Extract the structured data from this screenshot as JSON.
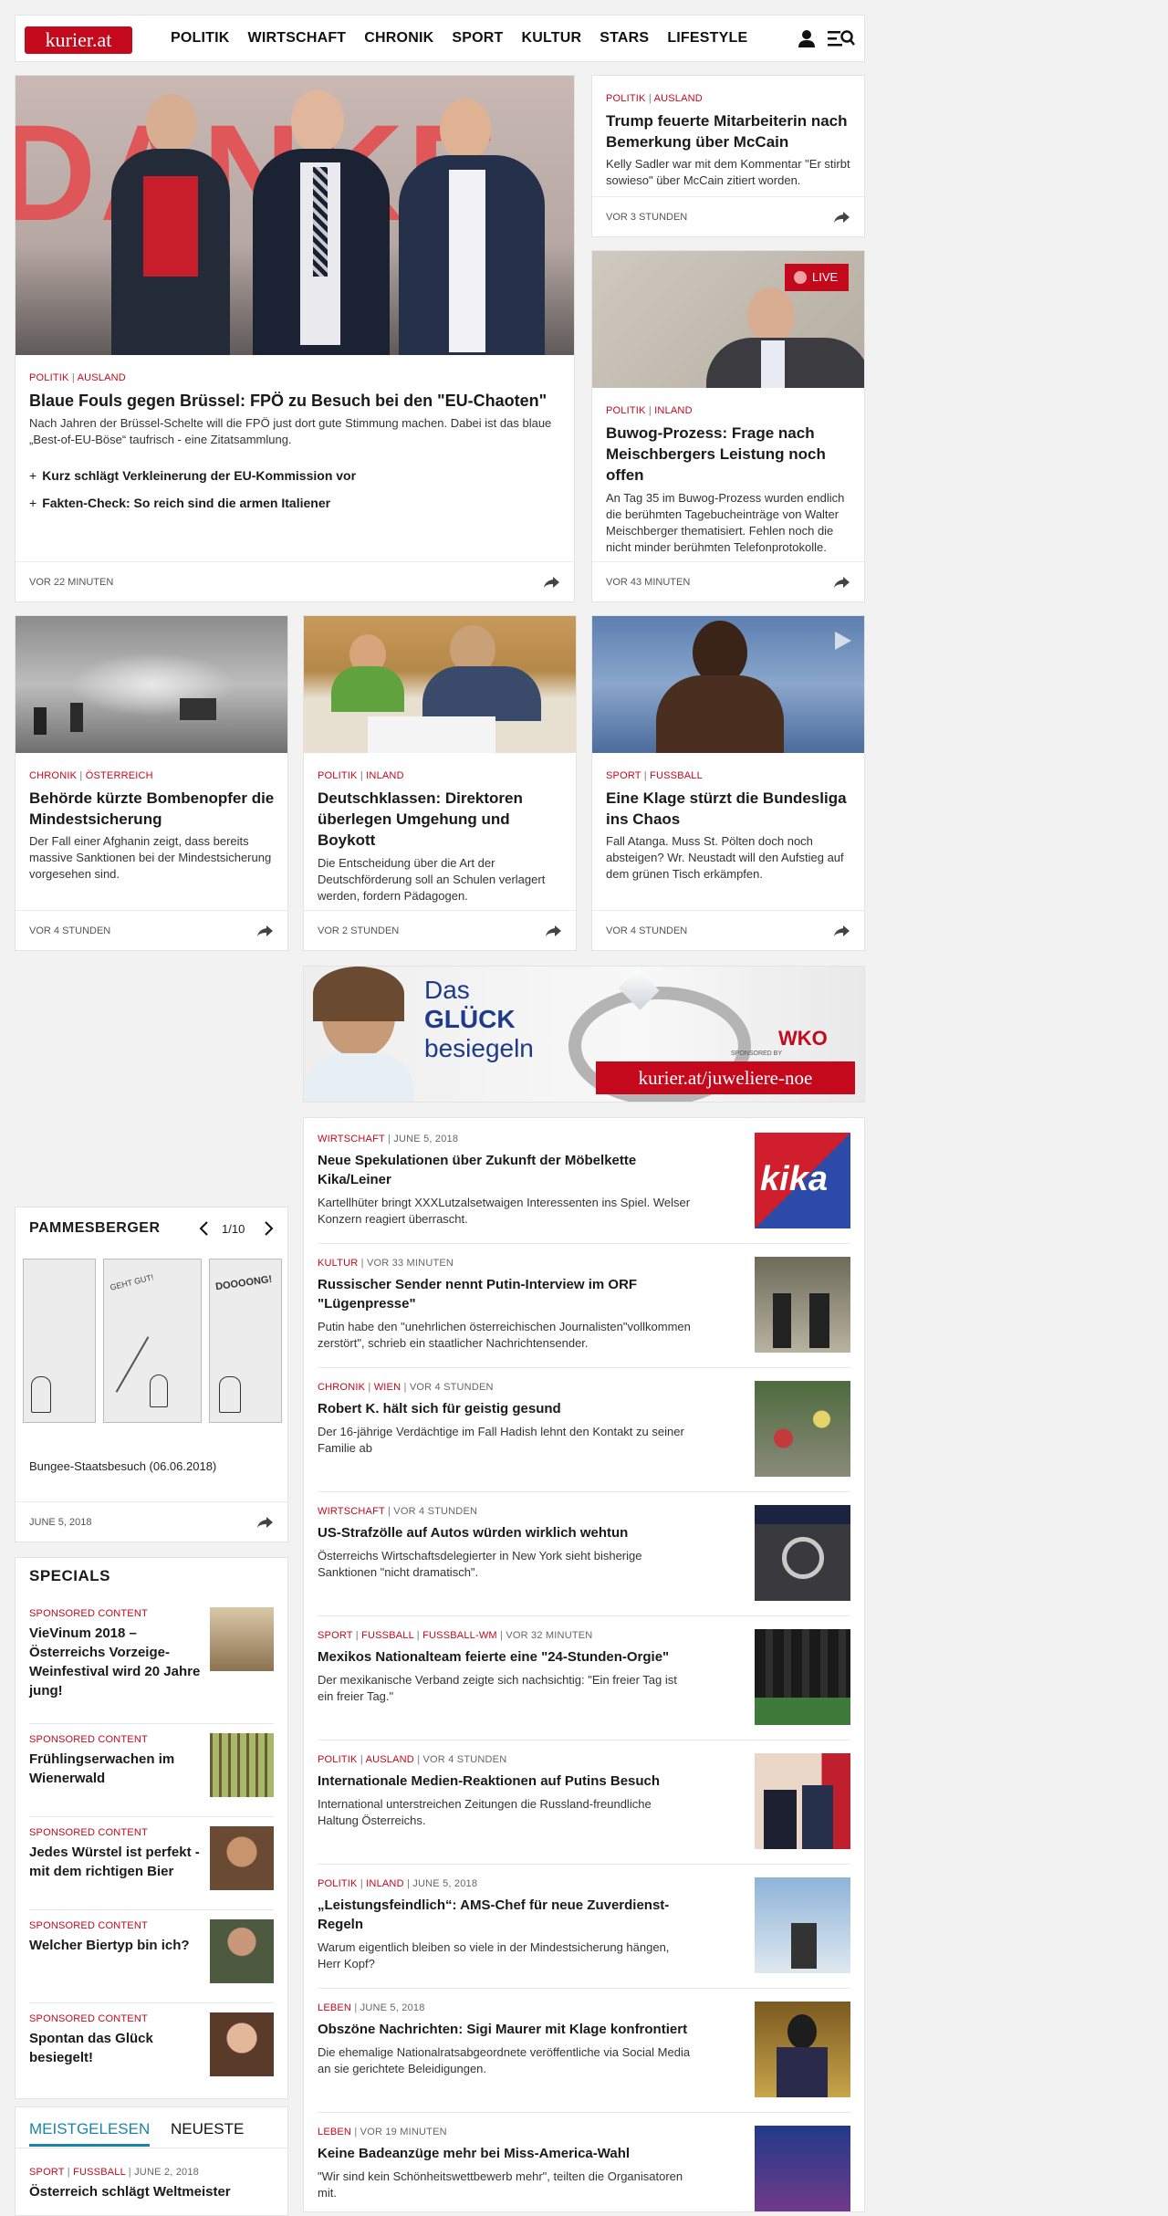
{
  "header": {
    "logo": "kurier.at",
    "nav": [
      "POLITIK",
      "WIRTSCHAFT",
      "CHRONIK",
      "SPORT",
      "KULTUR",
      "STARS",
      "LIFESTYLE"
    ]
  },
  "hero": {
    "cat1": "POLITIK",
    "cat2": "AUSLAND",
    "title": "Blaue Fouls gegen Brüssel: FPÖ zu Besuch bei den \"EU-Chaoten\"",
    "teaser": "Nach Jahren der Brüssel-Schelte will die FPÖ just dort gute Stimmung machen. Dabei ist das blaue „Best-of-EU-Böse“ taufrisch - eine Zitatsammlung.",
    "related": [
      "Kurz schlägt Verkleinerung der EU-Kommission vor",
      "Fakten-Check: So reich sind die armen Italiener"
    ],
    "time": "VOR 22 MINUTEN",
    "banner_text": "DANKE"
  },
  "side1": {
    "cat1": "POLITIK",
    "cat2": "AUSLAND",
    "title": "Trump feuerte Mitarbeiterin nach Bemerkung über McCain",
    "teaser": "Kelly Sadler war mit dem Kommentar \"Er stirbt sowieso\" über McCain zitiert worden.",
    "time": "VOR 3 STUNDEN"
  },
  "side2": {
    "live": "LIVE",
    "cat1": "POLITIK",
    "cat2": "INLAND",
    "title": "Buwog-Prozess: Frage nach Meischbergers Leistung noch offen",
    "teaser": "An Tag 35 im Buwog-Prozess wurden endlich die berühmten Tagebucheinträge von Walter Meischberger thematisiert. Fehlen noch die nicht minder berühmten Telefonprotokolle.",
    "time": "VOR 43 MINUTEN"
  },
  "row2": [
    {
      "cat1": "CHRONIK",
      "cat2": "ÖSTERREICH",
      "title": "Behörde kürzte Bombenopfer die Mindestsicherung",
      "teaser": "Der Fall einer Afghanin zeigt, dass bereits massive Sanktionen bei der Mindestsicherung vorgesehen sind.",
      "time": "VOR 4 STUNDEN"
    },
    {
      "cat1": "POLITIK",
      "cat2": "INLAND",
      "title": "Deutschklassen: Direktoren überlegen Umgehung und Boykott",
      "teaser": "Die Entscheidung über die Art der Deutschförderung soll an Schulen verlagert werden, fordern Pädagogen.",
      "time": "VOR 2 STUNDEN"
    },
    {
      "cat1": "SPORT",
      "cat2": "FUSSBALL",
      "title": "Eine Klage stürzt die Bundesliga ins Chaos",
      "teaser": "Fall Atanga. Muss St. Pölten doch noch absteigen? Wr. Neustadt will den Aufstieg auf dem grünen Tisch erkämpfen.",
      "time": "VOR 4 STUNDEN"
    }
  ],
  "ad": {
    "line1": "Das",
    "line2": "GLÜCK",
    "line3": "besiegeln",
    "url": "kurier.at/juweliere-noe",
    "sponsor": "SPONSORED BY",
    "brand": "WKO"
  },
  "list": [
    {
      "cats": [
        "WIRTSCHAFT"
      ],
      "time": "JUNE 5, 2018",
      "title": "Neue Spekulationen über Zukunft der Möbelkette Kika/Leiner",
      "teaser": "Kartellhüter bringt XXXLutzalsetwaigen Interessenten ins Spiel. Welser Konzern reagiert überrascht."
    },
    {
      "cats": [
        "KULTUR"
      ],
      "time": "VOR 33 MINUTEN",
      "title": "Russischer Sender nennt Putin-Interview im ORF \"Lügenpresse\"",
      "teaser": "Putin habe den \"unehrlichen österreichischen Journalisten\"vollkommen zerstört\", schrieb ein staatlicher Nachrichtensender."
    },
    {
      "cats": [
        "CHRONIK",
        "WIEN"
      ],
      "time": "VOR 4 STUNDEN",
      "title": "Robert K. hält sich für geistig gesund",
      "teaser": "Der 16-jährige Verdächtige im Fall Hadish lehnt den Kontakt zu seiner Familie ab"
    },
    {
      "cats": [
        "WIRTSCHAFT"
      ],
      "time": "VOR 4 STUNDEN",
      "title": "US-Strafzölle auf Autos würden wirklich wehtun",
      "teaser": "Österreichs Wirtschaftsdelegierter in New York sieht bisherige Sanktionen \"nicht dramatisch\"."
    },
    {
      "cats": [
        "SPORT",
        "FUSSBALL",
        "FUSSBALL-WM"
      ],
      "time": "VOR 32 MINUTEN",
      "title": "Mexikos Nationalteam feierte eine \"24-Stunden-Orgie\"",
      "teaser": "Der mexikanische Verband zeigte sich nachsichtig: \"Ein freier Tag ist ein freier Tag.\""
    },
    {
      "cats": [
        "POLITIK",
        "AUSLAND"
      ],
      "time": "VOR 4 STUNDEN",
      "title": "Internationale Medien-Reaktionen auf Putins Besuch",
      "teaser": "International unterstreichen Zeitungen die Russland-freundliche Haltung Österreichs."
    },
    {
      "cats": [
        "POLITIK",
        "INLAND"
      ],
      "time": "JUNE 5, 2018",
      "title": "„Leistungsfeindlich“: AMS-Chef für neue Zuverdienst-Regeln",
      "teaser": "Warum eigentlich bleiben so viele in der Mindestsicherung hängen, Herr Kopf?"
    },
    {
      "cats": [
        "LEBEN"
      ],
      "time": "JUNE 5, 2018",
      "title": "Obszöne Nachrichten: Sigi Maurer mit Klage konfrontiert",
      "teaser": "Die ehemalige Nationalratsabgeordnete veröffentliche via Social Media an sie gerichtete Beleidigungen."
    },
    {
      "cats": [
        "LEBEN"
      ],
      "time": "VOR 19 MINUTEN",
      "title": "Keine Badeanzüge mehr bei Miss-America-Wahl",
      "teaser": "\"Wir sind kein Schönheitswettbewerb mehr\", teilten die Organisatoren mit."
    }
  ],
  "pammesberger": {
    "title": "PAMMESBERGER",
    "counter": "1/10",
    "caption": "Bungee-Staatsbesuch (06.06.2018)",
    "date": "JUNE 5, 2018",
    "bubble1": "GEHT GUT!",
    "bubble2": "DOOOONG!"
  },
  "specials": {
    "title": "SPECIALS",
    "items": [
      {
        "label": "SPONSORED CONTENT",
        "title": "VieVinum 2018 – Österreichs Vorzeige-Weinfestival wird 20 Jahre jung!"
      },
      {
        "label": "SPONSORED CONTENT",
        "title": "Frühlingserwachen im Wienerwald"
      },
      {
        "label": "SPONSORED CONTENT",
        "title": "Jedes Würstel ist perfekt - mit dem richtigen Bier"
      },
      {
        "label": "SPONSORED CONTENT",
        "title": "Welcher Biertyp bin ich?"
      },
      {
        "label": "SPONSORED CONTENT",
        "title": "Spontan das Glück besiegelt!"
      }
    ]
  },
  "meist": {
    "tab1": "MEISTGELESEN",
    "tab2": "NEUESTE",
    "cat1": "SPORT",
    "cat2": "FUSSBALL",
    "time": "JUNE 2, 2018",
    "title": "Österreich schlägt Weltmeister"
  },
  "colors": {
    "accent": "#c4091c",
    "tab": "#1a84a8"
  }
}
